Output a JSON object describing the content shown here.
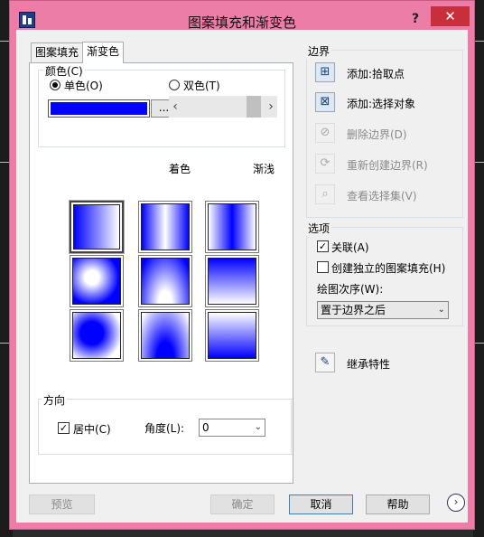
{
  "window": {
    "title": "图案填充和渐变色",
    "help": "?",
    "close": "✕"
  },
  "tabs": [
    {
      "label": "图案填充",
      "active": false
    },
    {
      "label": "渐变色",
      "active": true
    }
  ],
  "color": {
    "group_label": "颜色(C)",
    "single_label": "单色(O)",
    "double_label": "双色(T)",
    "mode": "single",
    "swatch_color": "#0000ff",
    "dots": "...",
    "slider_left": "‹",
    "slider_right": "›",
    "shade_label": "着色",
    "tint_label": "渐浅"
  },
  "gradient_patterns": [
    {
      "name": "linear",
      "selected": true
    },
    {
      "name": "cylinder",
      "selected": false
    },
    {
      "name": "invcylinder",
      "selected": false
    },
    {
      "name": "spherical",
      "selected": false
    },
    {
      "name": "hemispherical",
      "selected": false
    },
    {
      "name": "curved",
      "selected": false
    },
    {
      "name": "invspherical",
      "selected": false
    },
    {
      "name": "invhemispherical",
      "selected": false
    },
    {
      "name": "invcurved",
      "selected": false
    }
  ],
  "orientation": {
    "group_label": "方向",
    "centered_label": "居中(C)",
    "centered_checked": true,
    "angle_label": "角度(L):",
    "angle_value": "0"
  },
  "boundaries": {
    "group_label": "边界",
    "items": [
      {
        "label": "添加:拾取点",
        "icon": "pick-point-icon",
        "enabled": true
      },
      {
        "label": "添加:选择对象",
        "icon": "select-objects-icon",
        "enabled": true
      },
      {
        "label": "删除边界(D)",
        "icon": "remove-boundary-icon",
        "enabled": false
      },
      {
        "label": "重新创建边界(R)",
        "icon": "recreate-boundary-icon",
        "enabled": false
      },
      {
        "label": "查看选择集(V)",
        "icon": "view-selections-icon",
        "enabled": false
      }
    ]
  },
  "options": {
    "group_label": "选项",
    "associative_label": "关联(A)",
    "associative_checked": true,
    "separate_label": "创建独立的图案填充(H)",
    "separate_checked": false,
    "draw_order_label": "绘图次序(W):",
    "draw_order_value": "置于边界之后"
  },
  "inherit": {
    "label": "继承特性"
  },
  "buttons": {
    "preview": "预览",
    "ok": "确定",
    "cancel": "取消",
    "help": "帮助"
  },
  "colors": {
    "frame": "#ec7da6",
    "close": "#c7303a",
    "accent_blue": "#0000ff"
  }
}
